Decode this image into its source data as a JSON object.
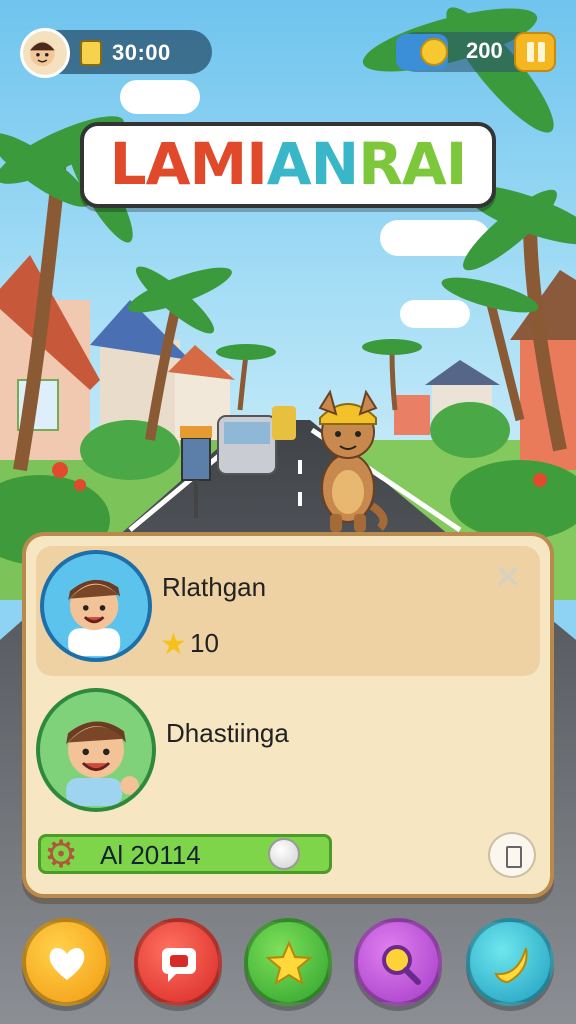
{
  "hud": {
    "timer": "30:00",
    "coins": "200",
    "timer_icon": "timer-icon",
    "coin_icon": "coin-icon",
    "pause_icon": "pause-icon"
  },
  "title": {
    "part1": "LAMI",
    "part2": "AN",
    "part3": "RAI"
  },
  "panel": {
    "player1": {
      "name": "Rlathgan",
      "score": "10",
      "icon": "star-icon"
    },
    "player2": {
      "name": "Dhastiinga"
    },
    "progress": {
      "label": "Al 20114",
      "icon": "gear-icon"
    },
    "close_icon": "close-icon",
    "close_glyph": "×"
  },
  "bottom_buttons": [
    {
      "icon": "heart-icon"
    },
    {
      "icon": "chat-icon"
    },
    {
      "icon": "star-icon"
    },
    {
      "icon": "search-icon"
    },
    {
      "icon": "banana-icon"
    }
  ],
  "colors": {
    "panel_bg": "#f7e6c2",
    "panel_border": "#b98a4e",
    "progress_fill": "#7fd54a",
    "title_red": "#e04a2a",
    "title_teal": "#39b7c9",
    "title_green": "#7cc83a"
  }
}
